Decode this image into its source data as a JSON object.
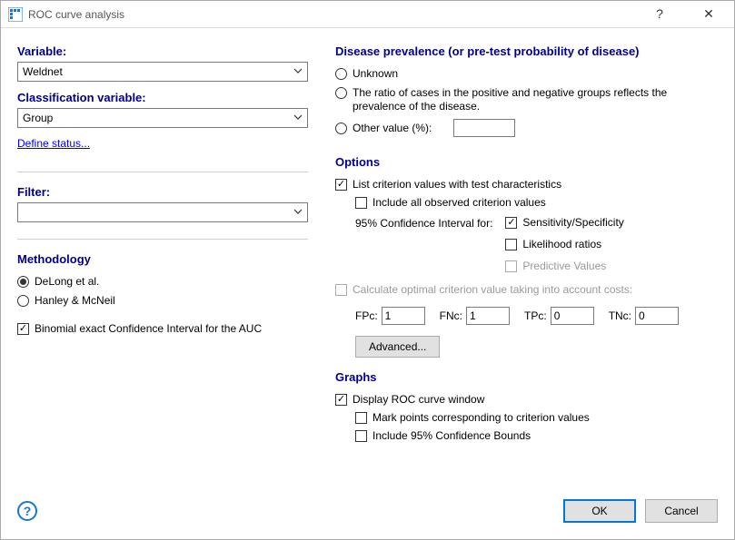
{
  "titlebar": {
    "title": "ROC curve analysis"
  },
  "left": {
    "variable_label": "Variable:",
    "variable_value": "Weldnet",
    "classvar_label": "Classification variable:",
    "classvar_value": "Group",
    "define_status": "Define status...",
    "filter_label": "Filter:",
    "filter_value": "",
    "methodology_label": "Methodology",
    "method_delong": "DeLong et al.",
    "method_hanley": "Hanley & McNeil",
    "binomial_ci": "Binomial exact Confidence Interval for the AUC"
  },
  "right": {
    "prevalence_label": "Disease prevalence (or pre-test probability of disease)",
    "prev_unknown": "Unknown",
    "prev_ratio": "The ratio of cases in the positive and negative groups reflects the prevalence of the disease.",
    "prev_other": "Other value (%):",
    "prev_other_value": "",
    "options_label": "Options",
    "opt_list_criterion": "List criterion values with test characteristics",
    "opt_include_all": "Include all observed criterion values",
    "opt_ci_label": "95% Confidence Interval for:",
    "opt_ci_sens": "Sensitivity/Specificity",
    "opt_ci_lr": "Likelihood ratios",
    "opt_ci_pv": "Predictive Values",
    "opt_calc_optimal": "Calculate optimal criterion value taking into account costs:",
    "fpc_label": "FPc:",
    "fpc_value": "1",
    "fnc_label": "FNc:",
    "fnc_value": "1",
    "tpc_label": "TPc:",
    "tpc_value": "0",
    "tnc_label": "TNc:",
    "tnc_value": "0",
    "advanced_btn": "Advanced...",
    "graphs_label": "Graphs",
    "graph_display": "Display ROC curve window",
    "graph_mark": "Mark points corresponding to criterion values",
    "graph_ci": "Include 95% Confidence Bounds"
  },
  "footer": {
    "ok": "OK",
    "cancel": "Cancel"
  }
}
